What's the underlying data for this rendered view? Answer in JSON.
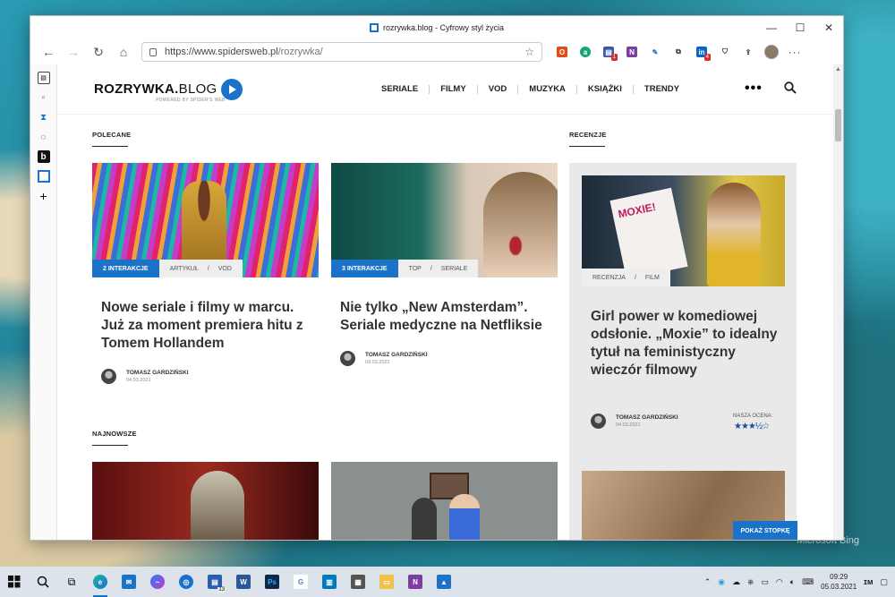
{
  "window": {
    "title": "rozrywka.blog - Cyfrowy styl życia"
  },
  "addressbar": {
    "url_host": "https://www.spidersweb.pl",
    "url_path": "/rozrywka/"
  },
  "site": {
    "logo_main": "ROZRYWKA.",
    "logo_blog": "BLOG",
    "logo_sub": "POWERED BY SPIDER'S WEB",
    "nav": [
      "SERIALE",
      "FILMY",
      "VOD",
      "MUZYKA",
      "KSIĄŻKI",
      "TRENDY"
    ]
  },
  "sections": {
    "recommended": "POLECANE",
    "reviews": "RECENZJE",
    "newest": "NAJNOWSZE"
  },
  "cards": [
    {
      "interactions": "2 INTERAKCJE",
      "cats": [
        "ARTYKUŁ",
        "/",
        "VOD"
      ],
      "title": "Nowe seriale i filmy w marcu. Już za moment premiera hitu z Tomem Hollandem",
      "author": "TOMASZ GARDZIŃSKI",
      "date": "04.03.2021"
    },
    {
      "interactions": "3 INTERAKCJE",
      "cats": [
        "TOP",
        "/",
        "SERIALE"
      ],
      "title": "Nie tylko „New Amsterdam”. Seriale medyczne na Netfliksie",
      "author": "TOMASZ GARDZIŃSKI",
      "date": "03.03.2021"
    }
  ],
  "review": {
    "cats": [
      "RECENZJA",
      "/",
      "FILM"
    ],
    "title": "Girl power w komediowej odsłonie. „Moxie” to idealny tytuł na feministyczny wieczór filmowy",
    "author": "TOMASZ GARDZIŃSKI",
    "date": "04.03.2021",
    "rating_label": "NASZA OCENA:",
    "stars": "★★★½☆",
    "rating": 3.5
  },
  "show_footer": "POKAŻ STOPKĘ",
  "wallpaper_mark": "Microsoft Bing",
  "taskbar": {
    "time": "09:29",
    "date": "05.03.2021",
    "file_explorer_badge": "13"
  },
  "colors": {
    "accent": "#1a73c9"
  }
}
